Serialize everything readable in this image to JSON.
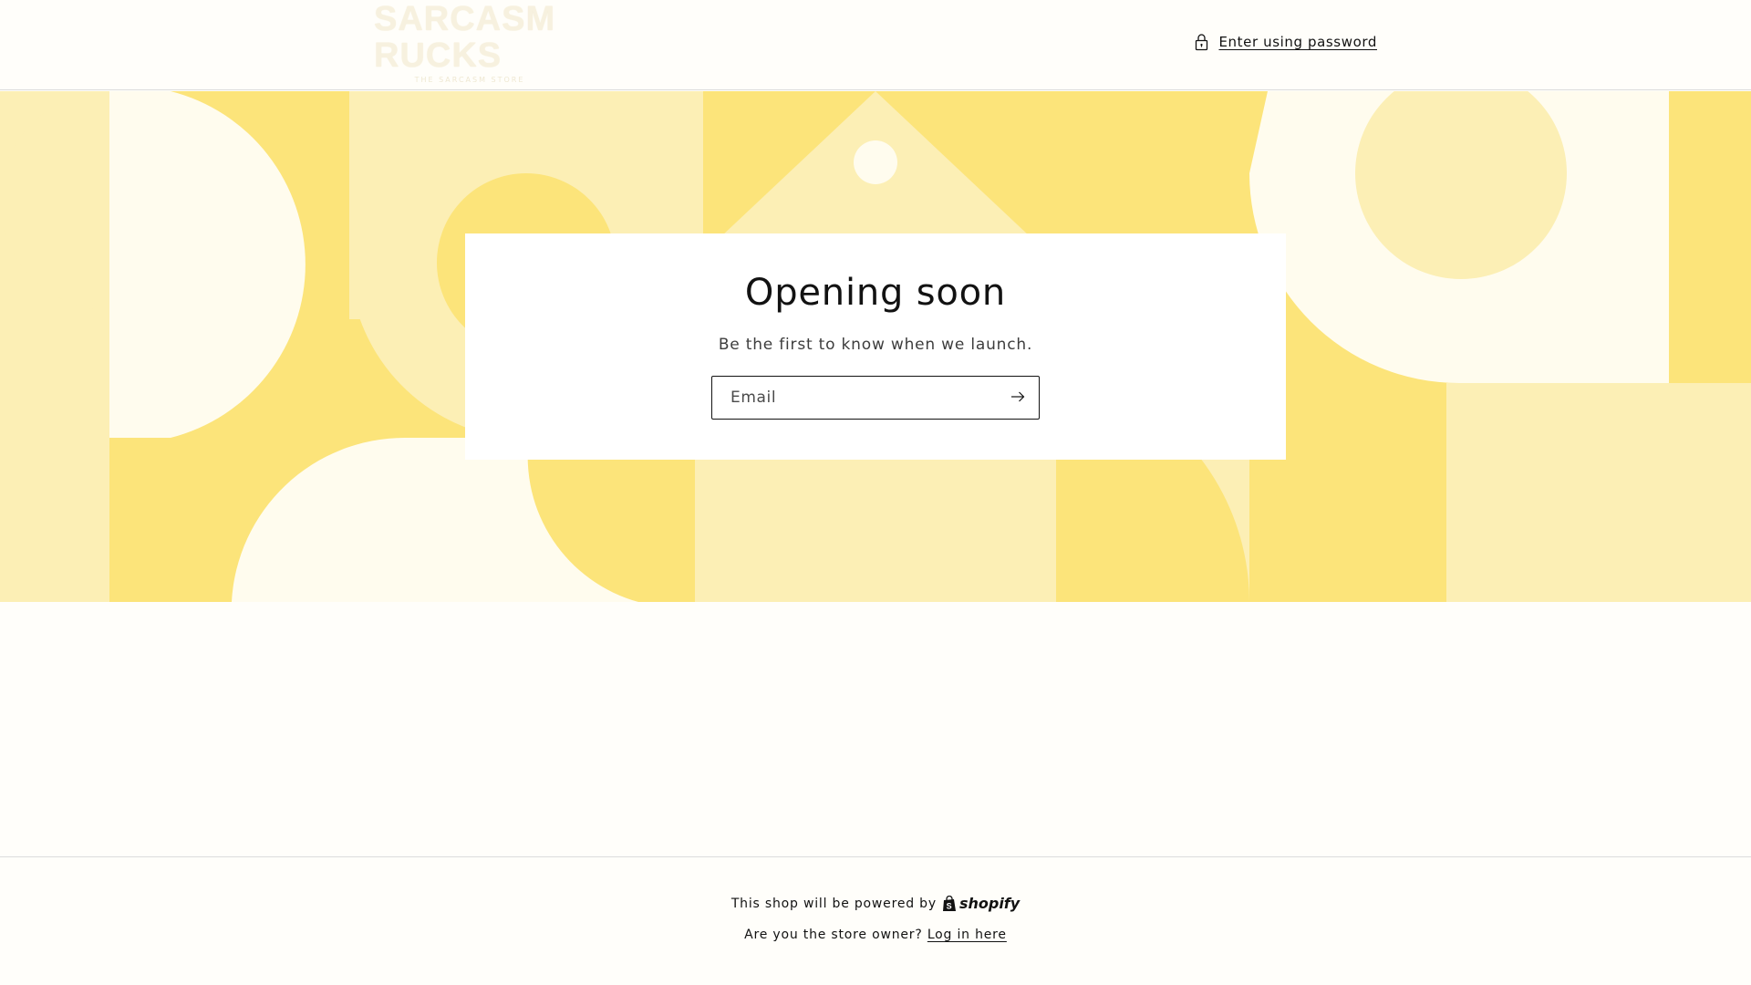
{
  "header": {
    "logo_text": "SARCASM RUCKS",
    "logo_tagline": "THE SARCASM STORE",
    "password_link_label": "Enter using password"
  },
  "card": {
    "title": "Opening soon",
    "subtitle": "Be the first to know when we launch.",
    "email_placeholder": "Email",
    "email_value": ""
  },
  "footer": {
    "powered_text": "This shop will be powered by",
    "shopify_label": "shopify",
    "owner_question": "Are you the store owner?",
    "login_label": "Log in here"
  },
  "colors": {
    "banner_dark": "#fce47a",
    "banner_mid": "#fcefb5",
    "banner_light": "#fffcee",
    "text": "#121212"
  },
  "icons": {
    "password": "lock-icon",
    "submit": "arrow-right-icon",
    "shopify": "shopify-bag-icon"
  }
}
